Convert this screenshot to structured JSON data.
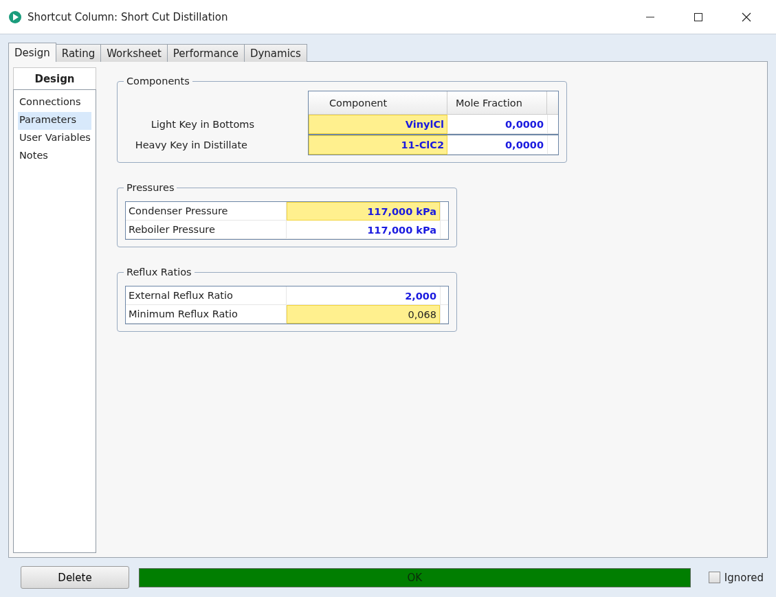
{
  "window": {
    "title": "Shortcut Column: Short Cut Distillation"
  },
  "tabs": [
    {
      "label": "Design",
      "selected": true
    },
    {
      "label": "Rating",
      "selected": false
    },
    {
      "label": "Worksheet",
      "selected": false
    },
    {
      "label": "Performance",
      "selected": false
    },
    {
      "label": "Dynamics",
      "selected": false
    }
  ],
  "sidebar": {
    "title": "Design",
    "items": [
      {
        "label": "Connections",
        "selected": false
      },
      {
        "label": "Parameters",
        "selected": true
      },
      {
        "label": "User Variables",
        "selected": false
      },
      {
        "label": "Notes",
        "selected": false
      }
    ]
  },
  "components": {
    "title": "Components",
    "columns": [
      "Component",
      "Mole Fraction"
    ],
    "rows": [
      {
        "label": "Light Key in Bottoms",
        "component": "VinylCl",
        "component_highlighted": true,
        "fraction": "0,0000",
        "fraction_highlighted": false
      },
      {
        "label": "Heavy Key in Distillate",
        "component": "11-ClC2",
        "component_highlighted": true,
        "fraction": "0,0000",
        "fraction_highlighted": false
      }
    ]
  },
  "groups": [
    {
      "title": "Pressures",
      "rows": [
        {
          "label": "Condenser Pressure",
          "value": "117,000 kPa",
          "highlighted": true,
          "user_specified": true
        },
        {
          "label": "Reboiler Pressure",
          "value": "117,000 kPa",
          "highlighted": false,
          "user_specified": true
        }
      ]
    },
    {
      "title": "Reflux Ratios",
      "rows": [
        {
          "label": "External Reflux Ratio",
          "value": "2,000",
          "highlighted": false,
          "user_specified": true
        },
        {
          "label": "Minimum Reflux Ratio",
          "value": "0,068",
          "highlighted": true,
          "user_specified": false
        }
      ]
    }
  ],
  "footer": {
    "delete_button": "Delete",
    "status": "OK",
    "ignored": {
      "label": "Ignored",
      "checked": false
    }
  }
}
